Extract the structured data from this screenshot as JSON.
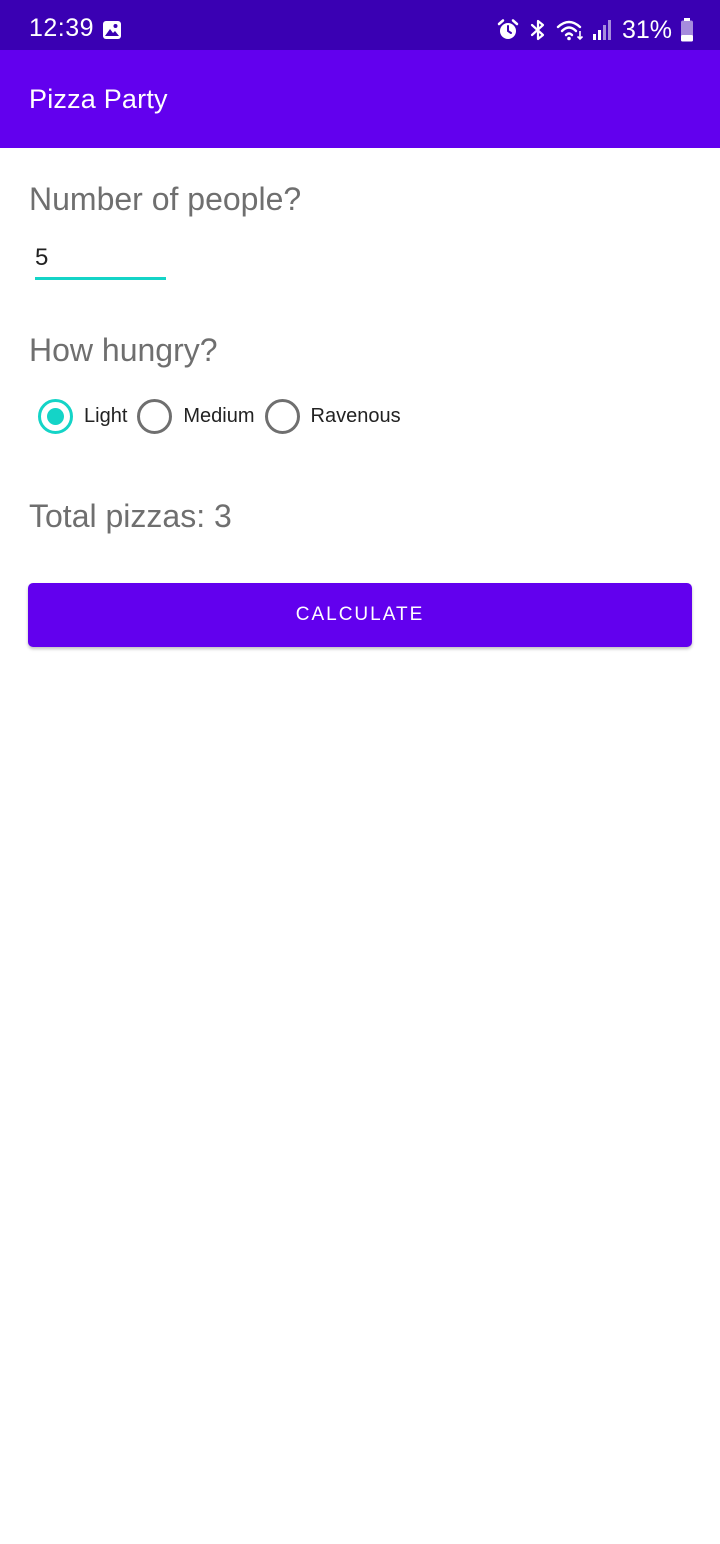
{
  "status_bar": {
    "time": "12:39",
    "battery_percent": "31%",
    "battery_level": 0.31,
    "icons": [
      "gallery-icon",
      "alarm-icon",
      "bluetooth-icon",
      "wifi-icon",
      "signal-icon",
      "battery-icon"
    ]
  },
  "app_bar": {
    "title": "Pizza Party"
  },
  "form": {
    "people_label": "Number of people?",
    "people_value": "5",
    "hungry_label": "How hungry?",
    "options": [
      {
        "label": "Light",
        "selected": true
      },
      {
        "label": "Medium",
        "selected": false
      },
      {
        "label": "Ravenous",
        "selected": false
      }
    ],
    "total_label": "Total pizzas:",
    "total_value": "3",
    "calculate_label": "CALCULATE"
  },
  "colors": {
    "status_bar": "#3a00b3",
    "primary": "#6200ee",
    "accent": "#14d4c7",
    "label_text": "#6f6f6f"
  }
}
